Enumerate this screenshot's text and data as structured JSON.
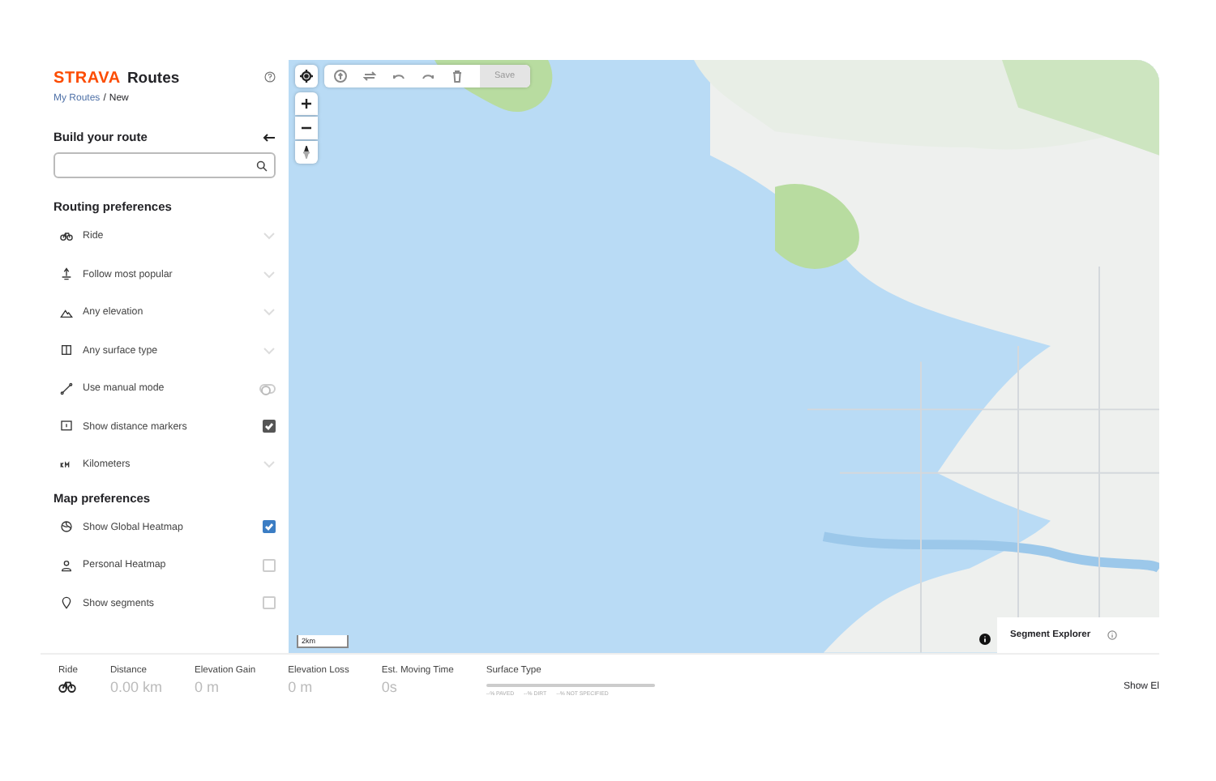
{
  "header": {
    "brand": "STRAVA",
    "product": "Routes",
    "breadcrumb": {
      "parent": "My Routes",
      "separator": "/",
      "current": "New"
    }
  },
  "build": {
    "title": "Build your route"
  },
  "routing": {
    "title": "Routing preferences",
    "items": [
      {
        "kind": "select",
        "label": "Ride"
      },
      {
        "kind": "select",
        "label": "Follow most popular"
      },
      {
        "kind": "select",
        "label": "Any elevation"
      },
      {
        "kind": "select",
        "label": "Any surface type"
      },
      {
        "kind": "toggle",
        "label": "Use manual mode",
        "on": false
      },
      {
        "kind": "checkbox",
        "label": "Show distance markers",
        "checked": true
      },
      {
        "kind": "select",
        "label": "Kilometers"
      }
    ]
  },
  "map_prefs": {
    "title": "Map preferences",
    "items": [
      {
        "kind": "checkbox",
        "label": "Show Global Heatmap",
        "checked": true
      },
      {
        "kind": "checkbox",
        "label": "Personal Heatmap",
        "checked": false
      },
      {
        "kind": "checkbox",
        "label": "Show segments",
        "checked": false
      }
    ]
  },
  "map": {
    "toolbar": {
      "save": {
        "label": "Save",
        "disabled": true
      }
    },
    "scale": "2km",
    "segment_explorer": "Segment Explorer"
  },
  "stats": [
    {
      "label": "Ride",
      "kind": "icon"
    },
    {
      "label": "Distance",
      "value": "0.00 km"
    },
    {
      "label": "Elevation Gain",
      "value": "0 m"
    },
    {
      "label": "Elevation Loss",
      "value": "0 m"
    },
    {
      "label": "Est. Moving Time",
      "value": "0s"
    }
  ],
  "surface": {
    "label": "Surface Type",
    "legend": [
      "--% PAVED",
      "--% DIRT",
      "--% NOT SPECIFIED"
    ]
  },
  "show_elevation": "Show El"
}
